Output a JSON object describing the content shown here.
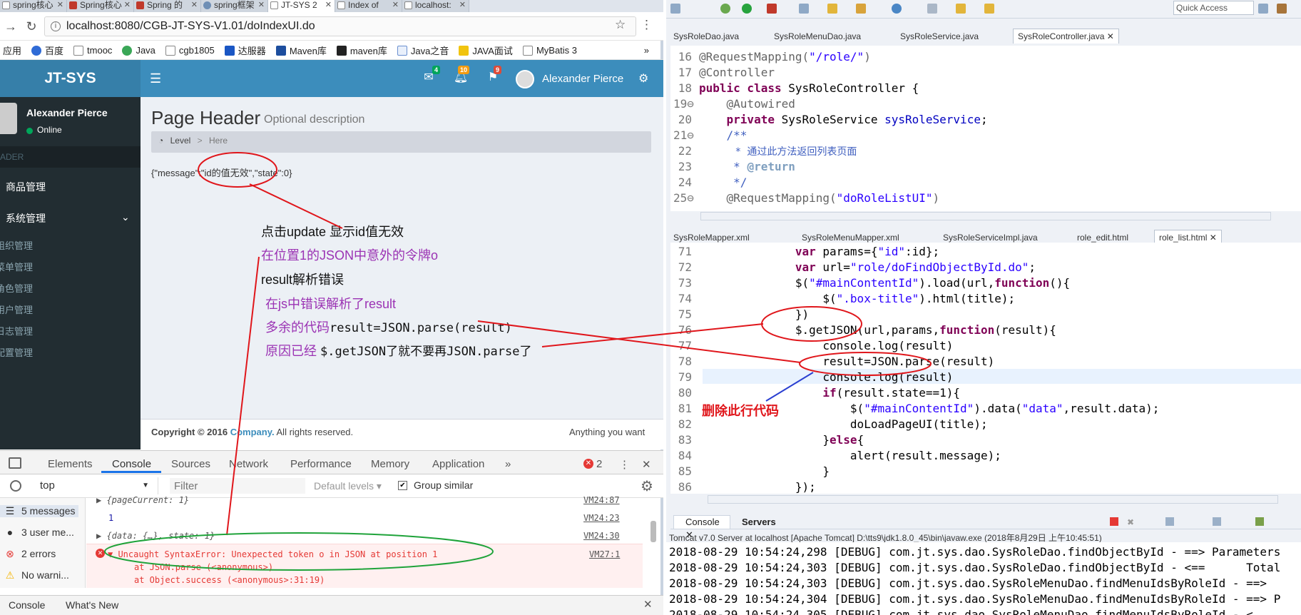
{
  "browser": {
    "tabs": [
      {
        "label": "spring核心"
      },
      {
        "label": "Spring核心"
      },
      {
        "label": "Spring 的"
      },
      {
        "label": "spring框架"
      },
      {
        "label": "JT-SYS 2"
      },
      {
        "label": "Index of"
      },
      {
        "label": "localhost:"
      }
    ],
    "url": "localhost:8080/CGB-JT-SYS-V1.01/doIndexUI.do",
    "bookmarks": [
      "应用",
      "百度",
      "tmooc",
      "Java",
      "cgb1805",
      "达服器",
      "Maven库",
      "maven库",
      "Java之音",
      "JAVA面试",
      "MyBatis 3"
    ],
    "bookmarks_more": "»"
  },
  "app": {
    "logo": "JT-SYS",
    "badges": {
      "mail": "4",
      "bell": "10",
      "flag": "9"
    },
    "user_name": "Alexander Pierce",
    "sidebar": {
      "user_name": "Alexander Pierce",
      "status": "Online",
      "header": "ADER",
      "items": [
        {
          "label": "商品管理"
        },
        {
          "label": "系统管理",
          "expanded_icon": "chevron-down"
        }
      ],
      "subitems": [
        "组织管理",
        "菜单管理",
        "角色管理",
        "用户管理",
        "日志管理",
        "配置管理"
      ]
    },
    "page_title": "Page Header",
    "page_subtitle": "Optional description",
    "breadcrumb": {
      "level": "Level",
      "sep": ">",
      "here": "Here"
    },
    "json_message": "{\"message\":\"id的值无效\",\"state\":0}",
    "footer": {
      "copyright_prefix": "Copyright © 2016 ",
      "company": "Company.",
      "rights": " All rights reserved.",
      "right_text": "Anything you want"
    }
  },
  "devtools": {
    "tabs": [
      "Elements",
      "Console",
      "Sources",
      "Network",
      "Performance",
      "Memory",
      "Application",
      "»"
    ],
    "active_tab": "Console",
    "error_count": "2",
    "context": "top",
    "filter_placeholder": "Filter",
    "levels": "Default levels",
    "group_similar": "Group similar",
    "sidebar": [
      {
        "label": "5 messages",
        "icon": "list-icon"
      },
      {
        "label": "3 user me...",
        "icon": "user-icon"
      },
      {
        "label": "2 errors",
        "icon": "error-icon"
      },
      {
        "label": "No warni...",
        "icon": "warning-icon"
      }
    ],
    "log": [
      {
        "text": "▶ {pageCurrent: 1}",
        "src": "VM24:87"
      },
      {
        "text": "1",
        "src": "VM24:23"
      },
      {
        "text": "▶ {data: {…}, state: 1}",
        "src": "VM24:30"
      }
    ],
    "error": {
      "text": "▼ Uncaught SyntaxError: Unexpected token o in JSON at position 1",
      "src": "VM27:1",
      "stack": [
        "at JSON.parse (<anonymous>)",
        "at Object.success (<anonymous>:31:19)"
      ]
    },
    "drawer_tabs": [
      "Console",
      "What's New"
    ]
  },
  "annotations": {
    "lines": [
      {
        "text": "点击update 显示id值无效",
        "color": "black"
      },
      {
        "text": "在位置1的JSON中意外的令牌o",
        "color": "purple"
      },
      {
        "text": "result解析错误",
        "color": "black"
      },
      {
        "text": "在js中错误解析了result",
        "color": "purple"
      },
      {
        "text": "多余的代码",
        "code": "result=JSON.parse(result)",
        "color": "purple"
      },
      {
        "text": "原因已经 ",
        "code": "$.getJSON了就不要再JSON.parse了",
        "color": "purple"
      }
    ],
    "delete_note": "删除此行代码"
  },
  "eclipse": {
    "quick_access": "Quick Access",
    "editor_tabs_top": [
      {
        "label": "SysRoleDao.java"
      },
      {
        "label": "SysRoleMenuDao.java"
      },
      {
        "label": "SysRoleService.java"
      },
      {
        "label": "SysRoleController.java",
        "active": true
      }
    ],
    "editor_top_lines": [
      {
        "num": "16",
        "html": "@RequestMapping(\"/role/\")"
      },
      {
        "num": "17",
        "html": "@Controller"
      },
      {
        "num": "18",
        "html": "public class SysRoleController {"
      },
      {
        "num": "19⊖",
        "html": "    @Autowired"
      },
      {
        "num": "20",
        "html": "    private SysRoleService sysRoleService;"
      },
      {
        "num": "21⊖",
        "html": "    /**"
      },
      {
        "num": "22",
        "html": "     * 通过此方法返回列表页面"
      },
      {
        "num": "23",
        "html": "     * @return"
      },
      {
        "num": "24",
        "html": "     */"
      },
      {
        "num": "25⊖",
        "html": "    @RequestMapping(\"doRoleListUI\")"
      }
    ],
    "editor_tabs_bottom": [
      {
        "label": "SysRoleMapper.xml"
      },
      {
        "label": "SysRoleMenuMapper.xml"
      },
      {
        "label": "SysRoleServiceImpl.java"
      },
      {
        "label": "role_edit.html"
      },
      {
        "label": "role_list.html",
        "active": true
      }
    ],
    "editor_bottom_lines": [
      {
        "num": "71",
        "text": "              var params={\"id\":id};"
      },
      {
        "num": "72",
        "text": "              var url=\"role/doFindObjectById.do\";"
      },
      {
        "num": "73",
        "text": "              $(\"#mainContentId\").load(url,function(){"
      },
      {
        "num": "74",
        "text": "                  $(\".box-title\").html(title);"
      },
      {
        "num": "75",
        "text": "              })"
      },
      {
        "num": "76",
        "text": "              $.getJSON(url,params,function(result){"
      },
      {
        "num": "77",
        "text": "                  console.log(result)"
      },
      {
        "num": "78",
        "text": "                  result=JSON.parse(result)"
      },
      {
        "num": "79",
        "text": "                  console.log(result)"
      },
      {
        "num": "80",
        "text": "                  if(result.state==1){"
      },
      {
        "num": "81",
        "text": "                      $(\"#mainContentId\").data(\"data\",result.data);"
      },
      {
        "num": "82",
        "text": "                      doLoadPageUI(title);"
      },
      {
        "num": "83",
        "text": "                  }else{"
      },
      {
        "num": "84",
        "text": "                      alert(result.message);"
      },
      {
        "num": "85",
        "text": "                  }"
      },
      {
        "num": "86",
        "text": "              });"
      }
    ],
    "console_tabs": [
      "Console",
      "Servers"
    ],
    "console_desc": "Tomcat v7.0 Server at localhost [Apache Tomcat] D:\\tts9\\jdk1.8.0_45\\bin\\javaw.exe (2018年8月29日 上午10:45:51)",
    "console_lines": [
      "2018-08-29 10:54:24,298 [DEBUG] com.jt.sys.dao.SysRoleDao.findObjectById - ==> Parameters",
      "2018-08-29 10:54:24,303 [DEBUG] com.jt.sys.dao.SysRoleDao.findObjectById - <==      Total",
      "2018-08-29 10:54:24,303 [DEBUG] com.jt.sys.dao.SysRoleMenuDao.findMenuIdsByRoleId - ==>",
      "2018-08-29 10:54:24,304 [DEBUG] com.jt.sys.dao.SysRoleMenuDao.findMenuIdsByRoleId - ==> P",
      "2018-08-29 10:54:24,305 [DEBUG] com.jt.sys.dao.SysRoleMenuDao.findMenuIdsByRoleId - <"
    ]
  },
  "colors": {
    "header_blue": "#3c8dbc",
    "sidebar_dark": "#222d32",
    "annotation_red": "#e0161b",
    "annotation_green": "#1fa33a",
    "annotation_purple": "#9b33b4"
  }
}
